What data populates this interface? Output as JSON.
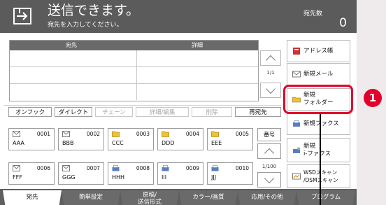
{
  "header": {
    "title": "送信できます。",
    "subtitle": "宛先を入力してください。",
    "count_label": "宛先数",
    "count": "0"
  },
  "destination_table": {
    "columns": [
      "宛先",
      "詳細"
    ],
    "page": "1/1"
  },
  "right_buttons": [
    {
      "label": "アドレス帳",
      "icon": "address-book-icon"
    },
    {
      "label": "新規メール",
      "icon": "mail-icon"
    },
    {
      "label": "新規\nフォルダー",
      "icon": "folder-icon"
    },
    {
      "label": "新規ファクス",
      "icon": "fax-icon"
    },
    {
      "label": "新規\ni-ファクス",
      "icon": "ifax-icon"
    },
    {
      "label": "WSDスキャン\n/DSMスキャン",
      "icon": "wsd-scan-icon"
    }
  ],
  "toolbar": {
    "on_hook": "オンフック",
    "direct": "ダイレクト",
    "chain": "チェーン",
    "detail_edit": "詳細/編集",
    "delete": "削除",
    "resend": "再宛先"
  },
  "address_grid": {
    "number_button": "番号",
    "page": "1/100",
    "entries": [
      {
        "num": "0001",
        "name": "AAA",
        "icon": "mail-icon"
      },
      {
        "num": "0002",
        "name": "BBB",
        "icon": "mail-icon"
      },
      {
        "num": "0003",
        "name": "CCC",
        "icon": "folder-icon"
      },
      {
        "num": "0004",
        "name": "DDD",
        "icon": "folder-icon"
      },
      {
        "num": "0005",
        "name": "EEE",
        "icon": "folder-icon"
      },
      {
        "num": "0006",
        "name": "FFF",
        "icon": "mail-icon"
      },
      {
        "num": "0007",
        "name": "GGG",
        "icon": "mail-icon"
      },
      {
        "num": "0008",
        "name": "HHH",
        "icon": "fax-icon"
      },
      {
        "num": "0009",
        "name": "III",
        "icon": "fax-icon"
      },
      {
        "num": "0010",
        "name": "JJJ",
        "icon": "fax-icon"
      }
    ]
  },
  "tabs": [
    {
      "label": "宛先",
      "active": true
    },
    {
      "label": "簡単設定",
      "active": false
    },
    {
      "label": "原稿/\n送信形式",
      "active": false
    },
    {
      "label": "カラー/画質",
      "active": false
    },
    {
      "label": "応用/その他",
      "active": false
    },
    {
      "label": "プログラム",
      "active": false
    }
  ],
  "callout": {
    "number": "1"
  },
  "colors": {
    "header_bg": "#5b5b5b",
    "accent_red": "#e2002d",
    "page_bg": "#efeaeb"
  }
}
